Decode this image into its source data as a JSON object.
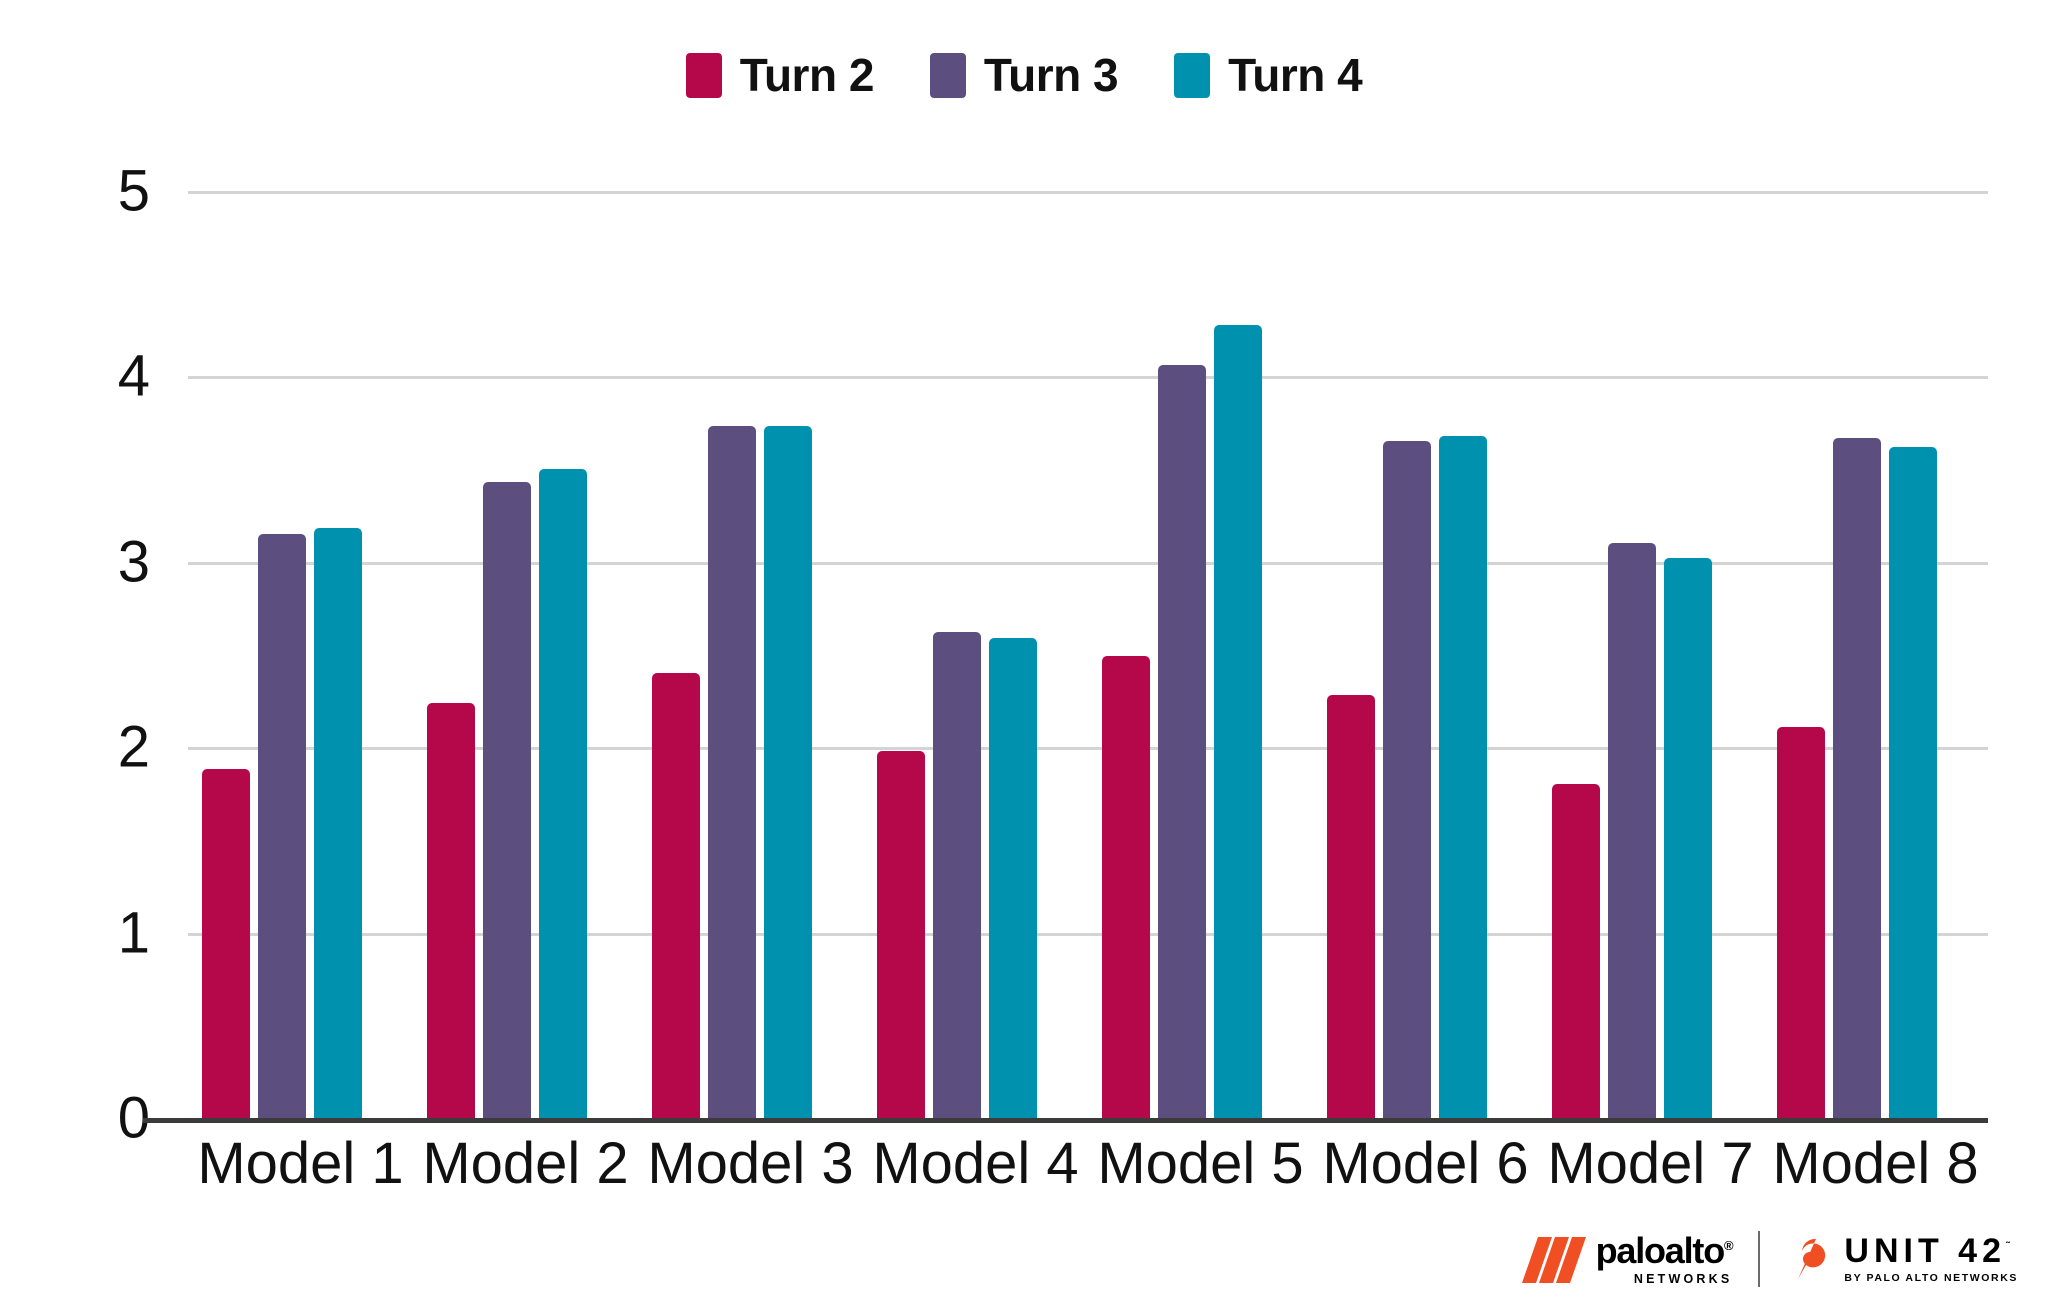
{
  "chart_data": {
    "type": "bar",
    "title": "",
    "xlabel": "",
    "ylabel": "",
    "ylim": [
      0,
      5
    ],
    "yticks": [
      "0",
      "1",
      "2",
      "3",
      "4",
      "5"
    ],
    "grid": true,
    "legend_position": "top-center",
    "categories": [
      "Model 1",
      "Model 2",
      "Model 3",
      "Model 4",
      "Model 5",
      "Model 6",
      "Model 7",
      "Model 8"
    ],
    "series": [
      {
        "name": "Turn 2",
        "color": "#b5084b",
        "values": [
          1.88,
          2.24,
          2.4,
          1.98,
          2.49,
          2.28,
          1.8,
          2.11
        ]
      },
      {
        "name": "Turn 3",
        "color": "#5c4f80",
        "values": [
          3.15,
          3.43,
          3.73,
          2.62,
          4.06,
          3.65,
          3.1,
          3.67
        ]
      },
      {
        "name": "Turn 4",
        "color": "#0091af",
        "values": [
          3.18,
          3.5,
          3.73,
          2.59,
          4.28,
          3.68,
          3.02,
          3.62
        ]
      }
    ]
  },
  "legend": {
    "items": [
      {
        "label": "Turn 2",
        "swatch": "legend-swatch-turn-2"
      },
      {
        "label": "Turn 3",
        "swatch": "legend-swatch-turn-3"
      },
      {
        "label": "Turn 4",
        "swatch": "legend-swatch-turn-4"
      }
    ]
  },
  "footer": {
    "paloalto": {
      "name": "paloalto",
      "registered": "®",
      "subtitle": "NETWORKS"
    },
    "unit42": {
      "name": "UNIT 42",
      "trademark": "˜",
      "subtitle": "BY PALO ALTO NETWORKS"
    }
  },
  "colors": {
    "turn2": "#b5084b",
    "turn3": "#5c4f80",
    "turn4": "#0091af",
    "gridline": "#d4d4d4",
    "axis": "#3b3b3b",
    "text": "#111111",
    "paloalto_orange": "#f04e23"
  }
}
